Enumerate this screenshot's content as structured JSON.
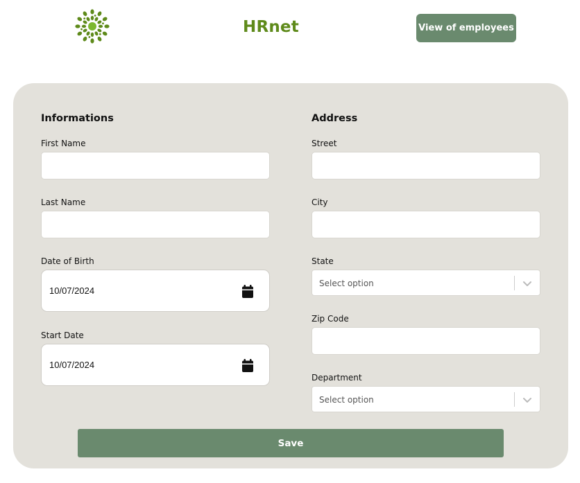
{
  "header": {
    "logo_icon": "sunburst-logo-icon",
    "brand": "HRnet",
    "nav_button": "View of employees",
    "accent": "#6a8a6e",
    "brand_color": "#5e8a1a"
  },
  "form": {
    "informations": {
      "title": "Informations",
      "first_name": {
        "label": "First Name",
        "value": ""
      },
      "last_name": {
        "label": "Last Name",
        "value": ""
      },
      "date_of_birth": {
        "label": "Date of Birth",
        "value": "10/07/2024",
        "icon": "calendar-icon"
      },
      "start_date": {
        "label": "Start Date",
        "value": "10/07/2024",
        "icon": "calendar-icon"
      }
    },
    "address": {
      "title": "Address",
      "street": {
        "label": "Street",
        "value": ""
      },
      "city": {
        "label": "City",
        "value": ""
      },
      "state": {
        "label": "State",
        "placeholder": "Select option",
        "icon": "chevron-down-icon"
      },
      "zip_code": {
        "label": "Zip Code",
        "value": ""
      }
    },
    "department": {
      "label": "Department",
      "placeholder": "Select option",
      "icon": "chevron-down-icon"
    },
    "save_label": "Save",
    "card_color": "#e3e1db"
  }
}
